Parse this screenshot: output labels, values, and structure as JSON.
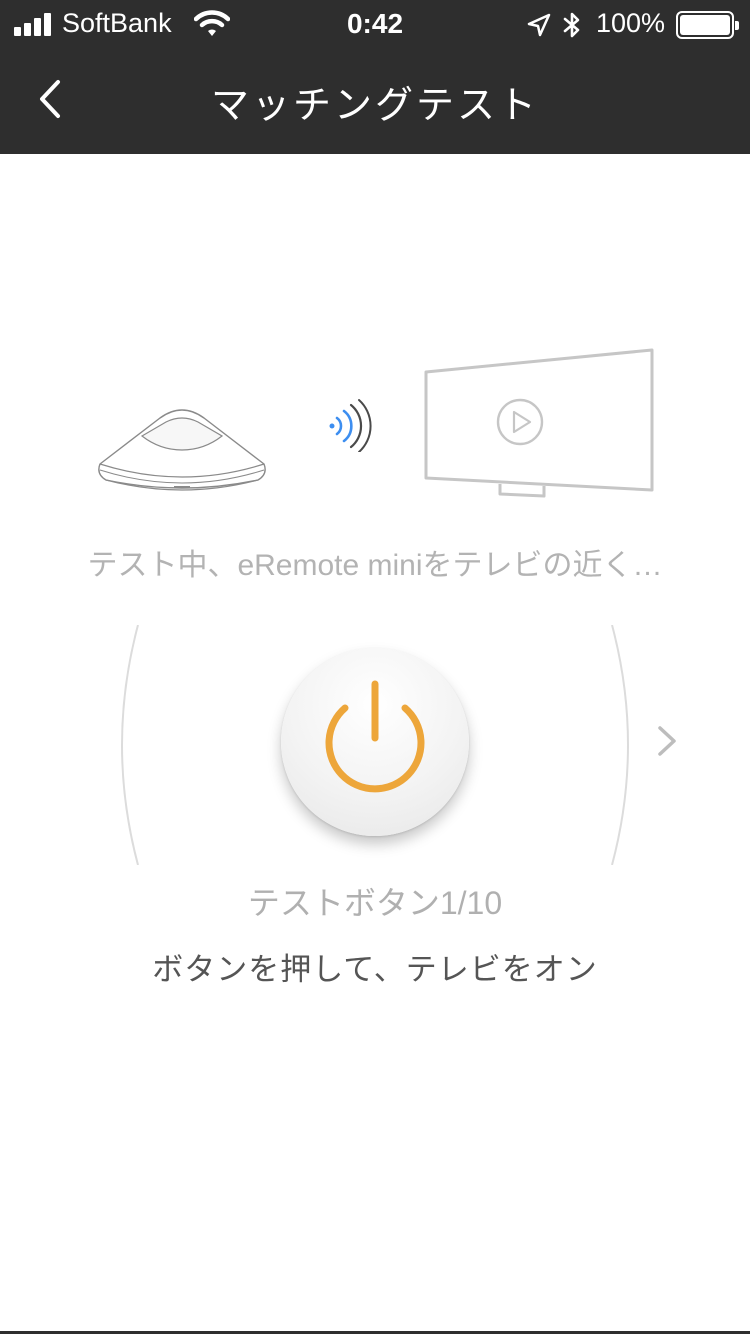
{
  "status_bar": {
    "carrier": "SoftBank",
    "time": "0:42",
    "battery_percent": "100%",
    "battery_level": 1.0,
    "icons": [
      "signal-icon",
      "wifi-icon",
      "location-arrow-icon",
      "bluetooth-icon",
      "battery-icon"
    ]
  },
  "nav": {
    "back_icon": "chevron-left-icon",
    "title": "マッチングテスト"
  },
  "illustration": {
    "icons": [
      "eremote-mini-device-icon",
      "signal-waves-icon",
      "tv-play-icon"
    ]
  },
  "hint_text": "テスト中、eRemote miniをテレビの近く…",
  "test": {
    "button_icon": "power-icon",
    "next_icon": "chevron-right-icon",
    "counter_label": "テストボタン1/10",
    "instruction": "ボタンを押して、テレビをオン"
  },
  "colors": {
    "header_bg": "#2e2e2e",
    "accent_orange": "#eda63a",
    "wave_blue": "#3d8ef0",
    "text_gray": "#b3b3b3",
    "instruction_gray": "#555555"
  }
}
